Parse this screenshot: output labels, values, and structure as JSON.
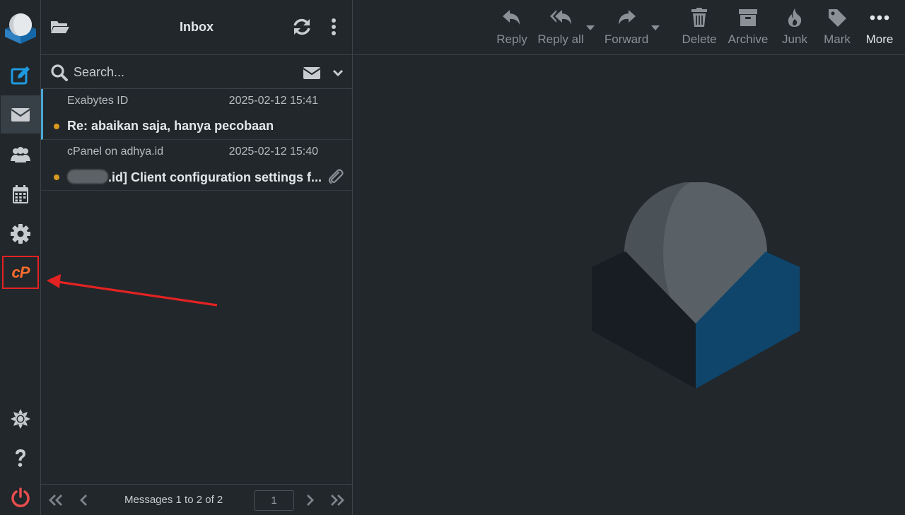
{
  "nav": {
    "items": [
      {
        "name": "compose",
        "icon": "compose-icon",
        "active": false
      },
      {
        "name": "mail",
        "icon": "envelope-icon",
        "active": true
      },
      {
        "name": "contacts",
        "icon": "contacts-icon",
        "active": false
      },
      {
        "name": "calendar",
        "icon": "calendar-icon",
        "active": false
      },
      {
        "name": "settings",
        "icon": "gear-icon",
        "active": false
      },
      {
        "name": "cpanel",
        "icon": "cpanel-icon",
        "label": "cP",
        "highlighted": true
      }
    ],
    "bottom": [
      {
        "name": "theme",
        "icon": "sun-icon"
      },
      {
        "name": "help",
        "icon": "question-icon"
      },
      {
        "name": "logout",
        "icon": "power-icon"
      }
    ]
  },
  "list": {
    "title": "Inbox",
    "search_placeholder": "Search...",
    "messages": [
      {
        "from": "Exabytes ID",
        "date": "2025-02-12 15:41",
        "subject": "Re: abaikan saja, hanya pecobaan",
        "unread": true,
        "selected": true,
        "attachment": false
      },
      {
        "from": "cPanel on adhya.id",
        "date": "2025-02-12 15:40",
        "subject_suffix": ".id] Client configuration settings f...",
        "unread": true,
        "selected": false,
        "attachment": true
      }
    ],
    "footer": {
      "count_text": "Messages 1 to 2 of 2",
      "page": "1"
    }
  },
  "toolbar": {
    "reply": "Reply",
    "reply_all": "Reply all",
    "forward": "Forward",
    "delete": "Delete",
    "archive": "Archive",
    "junk": "Junk",
    "mark": "Mark",
    "more": "More"
  },
  "colors": {
    "background": "#22272b",
    "accent_blue": "#1e9be0",
    "unread_dot": "#d79a1f",
    "cpanel_orange": "#ff6c2c",
    "highlight_red": "#e32222",
    "logout_red": "#e84d4d"
  }
}
